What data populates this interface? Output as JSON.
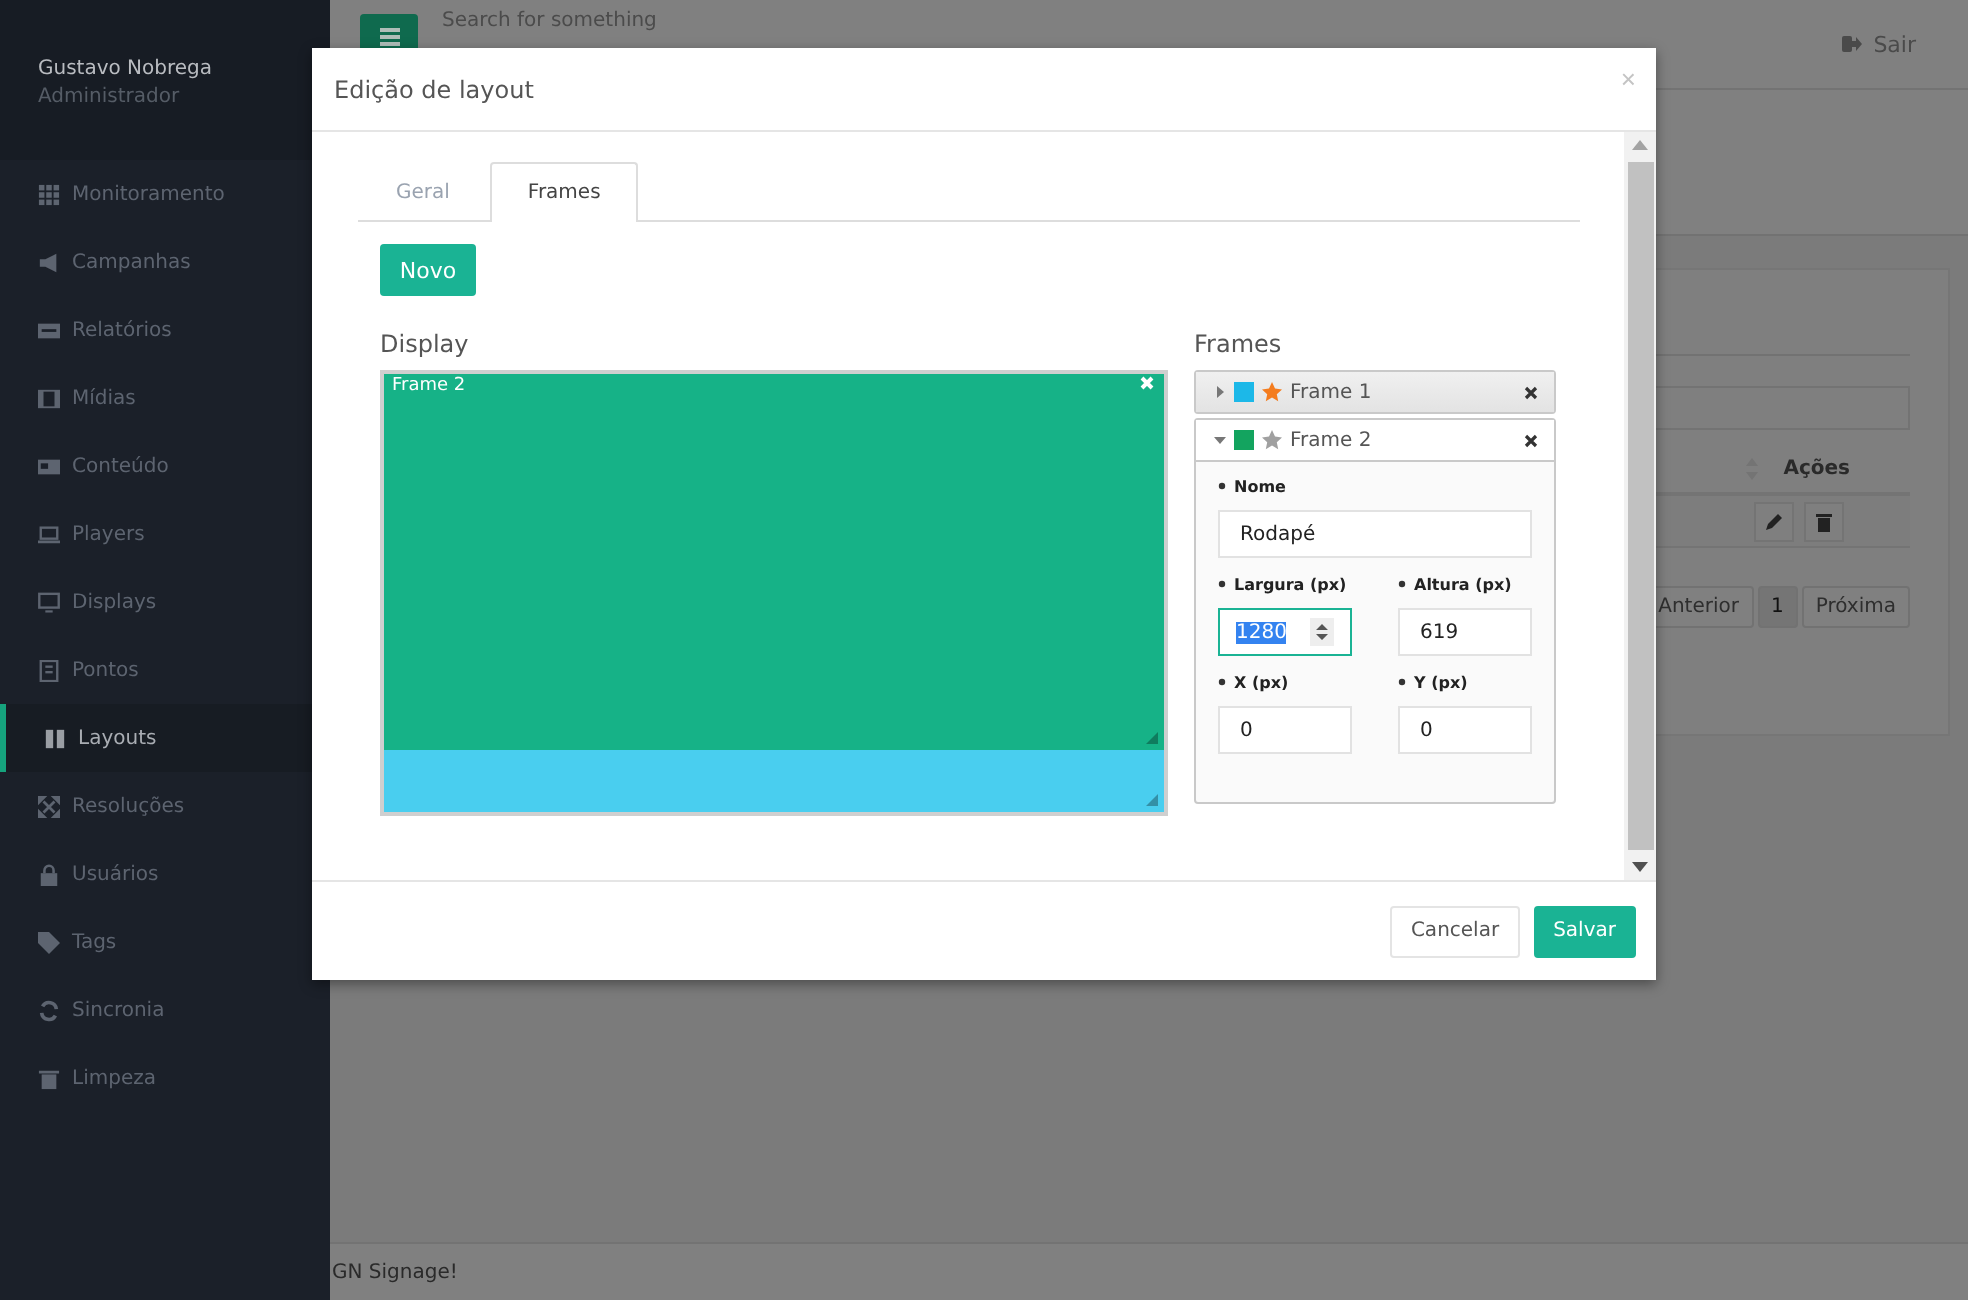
{
  "sidebar": {
    "user_name": "Gustavo Nobrega",
    "user_role": "Administrador",
    "items": [
      {
        "label": "Monitoramento",
        "selected": false
      },
      {
        "label": "Campanhas",
        "selected": false
      },
      {
        "label": "Relatórios",
        "selected": false
      },
      {
        "label": "Mídias",
        "selected": false
      },
      {
        "label": "Conteúdo",
        "selected": false
      },
      {
        "label": "Players",
        "selected": false
      },
      {
        "label": "Displays",
        "selected": false
      },
      {
        "label": "Pontos",
        "selected": false
      },
      {
        "label": "Layouts",
        "selected": true
      },
      {
        "label": "Resoluções",
        "selected": false
      },
      {
        "label": "Usuários",
        "selected": false
      },
      {
        "label": "Tags",
        "selected": false
      },
      {
        "label": "Sincronia",
        "selected": false
      },
      {
        "label": "Limpeza",
        "selected": false
      }
    ]
  },
  "topbar": {
    "search_placeholder": "Search for something",
    "logout": "Sair"
  },
  "table": {
    "columns": [
      "Ações"
    ],
    "pagination": {
      "prev": "Anterior",
      "pages": [
        {
          "label": "1",
          "selected": true
        }
      ],
      "next": "Próxima"
    }
  },
  "footer": "GN Signage!",
  "modal": {
    "title": "Edição de layout",
    "close": "×",
    "tabs": [
      {
        "label": "Geral",
        "selected": false
      },
      {
        "label": "Frames",
        "selected": true
      }
    ],
    "new_button": "Novo",
    "display": {
      "title": "Display",
      "regions": [
        {
          "label": "Frame 2",
          "color": "#16b287"
        },
        {
          "color": "#49ceef"
        }
      ]
    },
    "frames_title": "Frames",
    "frames": [
      {
        "name": "Frame 1",
        "color": "#1cb8e8",
        "primary": true,
        "expanded": false
      },
      {
        "name": "Frame 2",
        "color": "#13a45f",
        "primary": false,
        "expanded": true,
        "fields": [
          {
            "label": "Nome",
            "value": "Rodapé",
            "focused": false
          },
          {
            "label": "Largura (px)",
            "value": "1280",
            "focused": true
          },
          {
            "label": "Altura (px)",
            "value": "619",
            "focused": false
          },
          {
            "label": "X (px)",
            "value": "0",
            "focused": false
          },
          {
            "label": "Y (px)",
            "value": "0",
            "focused": false
          }
        ]
      }
    ],
    "buttons": [
      {
        "label": "Cancelar",
        "kind": "secondary"
      },
      {
        "label": "Salvar",
        "kind": "primary"
      }
    ]
  }
}
